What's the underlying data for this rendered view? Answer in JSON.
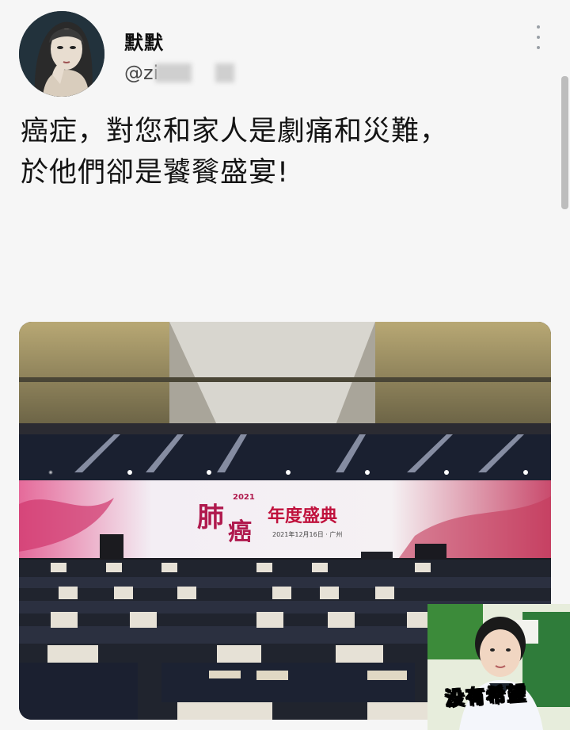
{
  "user": {
    "display_name": "默默",
    "handle": "@zi"
  },
  "post": {
    "line1": "癌症，對您和家人是劇痛和災難，",
    "line2": "於他們卻是饕餮盛宴!"
  },
  "photo": {
    "screen_char1": "肺",
    "screen_char2": "癌",
    "screen_year": "2021",
    "screen_event": "年度盛典",
    "screen_date": "2021年12月16日 · 广州"
  },
  "sticker": {
    "caption": "没有希望"
  },
  "icons": {
    "more": "more-vertical-icon"
  },
  "colors": {
    "background": "#f6f6f6",
    "text": "#141414",
    "screen_accent": "#b01a4e"
  }
}
